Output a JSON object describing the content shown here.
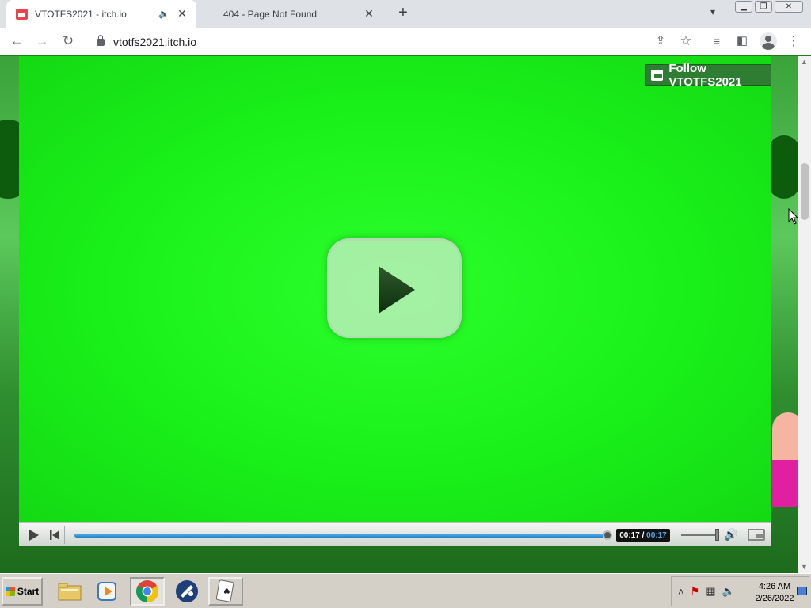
{
  "browser": {
    "tabs": [
      {
        "title": "VTOTFS2021 - itch.io",
        "active": true,
        "audio": true
      },
      {
        "title": "404 - Page Not Found",
        "active": false
      }
    ],
    "url": "vtotfs2021.itch.io"
  },
  "page": {
    "follow_button": "Follow VTOTFS2021",
    "player": {
      "current_time": "00:17",
      "separator": "/",
      "duration": "00:17",
      "progress": 1.0
    }
  },
  "taskbar": {
    "start_label": "Start",
    "apps": [
      "file-explorer",
      "media-player",
      "chrome",
      "network-tool",
      "solitaire"
    ],
    "clock_time": "4:26 AM",
    "clock_date": "2/26/2022"
  },
  "colors": {
    "green_screen": "#19f019",
    "follow_bg": "#2e7d32",
    "seek_bar": "#1f7cc7"
  }
}
